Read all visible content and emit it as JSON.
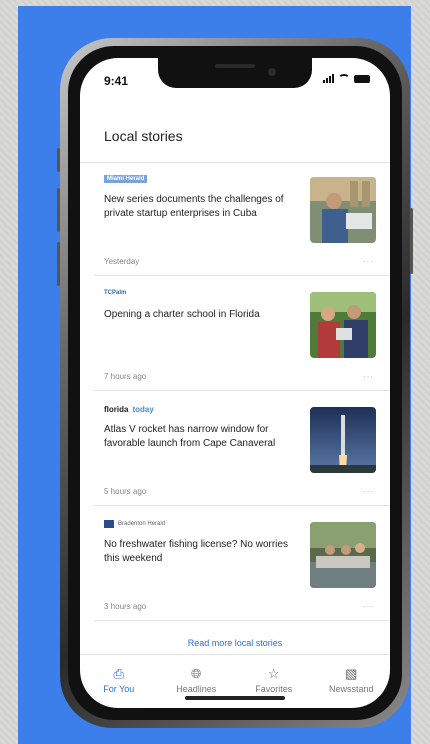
{
  "status": {
    "time": "9:41"
  },
  "header": {
    "title": "Local stories"
  },
  "stories": [
    {
      "source": "Miami Herald",
      "headline": "New series documents the challenges of private startup enterprises in Cuba",
      "time": "Yesterday"
    },
    {
      "source": "TCPalm",
      "headline": "Opening a charter school in Florida",
      "time": "7 hours ago"
    },
    {
      "source_part1": "florida",
      "source_part2": "today",
      "headline": "Atlas V rocket has narrow window for favorable launch from Cape Canaveral",
      "time": "5 hours ago"
    },
    {
      "source": "Bradenton Herald",
      "headline": "No freshwater fishing license? No worries this weekend",
      "time": "3 hours ago"
    }
  ],
  "read_more": "Read more local stories",
  "nav": [
    {
      "label": "For You",
      "icon": "for-you-icon",
      "active": true
    },
    {
      "label": "Headlines",
      "icon": "globe-icon"
    },
    {
      "label": "Favorites",
      "icon": "star-icon"
    },
    {
      "label": "Newsstand",
      "icon": "newsstand-icon"
    }
  ],
  "colors": {
    "background_blue": "#3d7fea",
    "accent": "#2d6dd8"
  }
}
